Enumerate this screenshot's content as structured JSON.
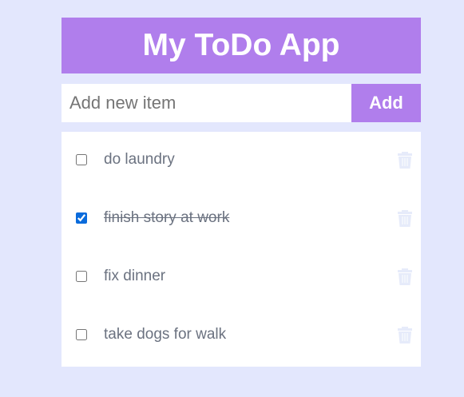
{
  "app": {
    "title": "My ToDo App",
    "accent_color": "#b07eec",
    "background_color": "#e3e7fd"
  },
  "add_form": {
    "placeholder": "Add new item",
    "value": "",
    "button_label": "Add"
  },
  "todos": [
    {
      "label": "do laundry",
      "done": false,
      "delete_icon": "trash-icon"
    },
    {
      "label": "finish story at work",
      "done": true,
      "delete_icon": "trash-icon"
    },
    {
      "label": "fix dinner",
      "done": false,
      "delete_icon": "trash-icon"
    },
    {
      "label": "take dogs for walk",
      "done": false,
      "delete_icon": "trash-icon"
    }
  ]
}
